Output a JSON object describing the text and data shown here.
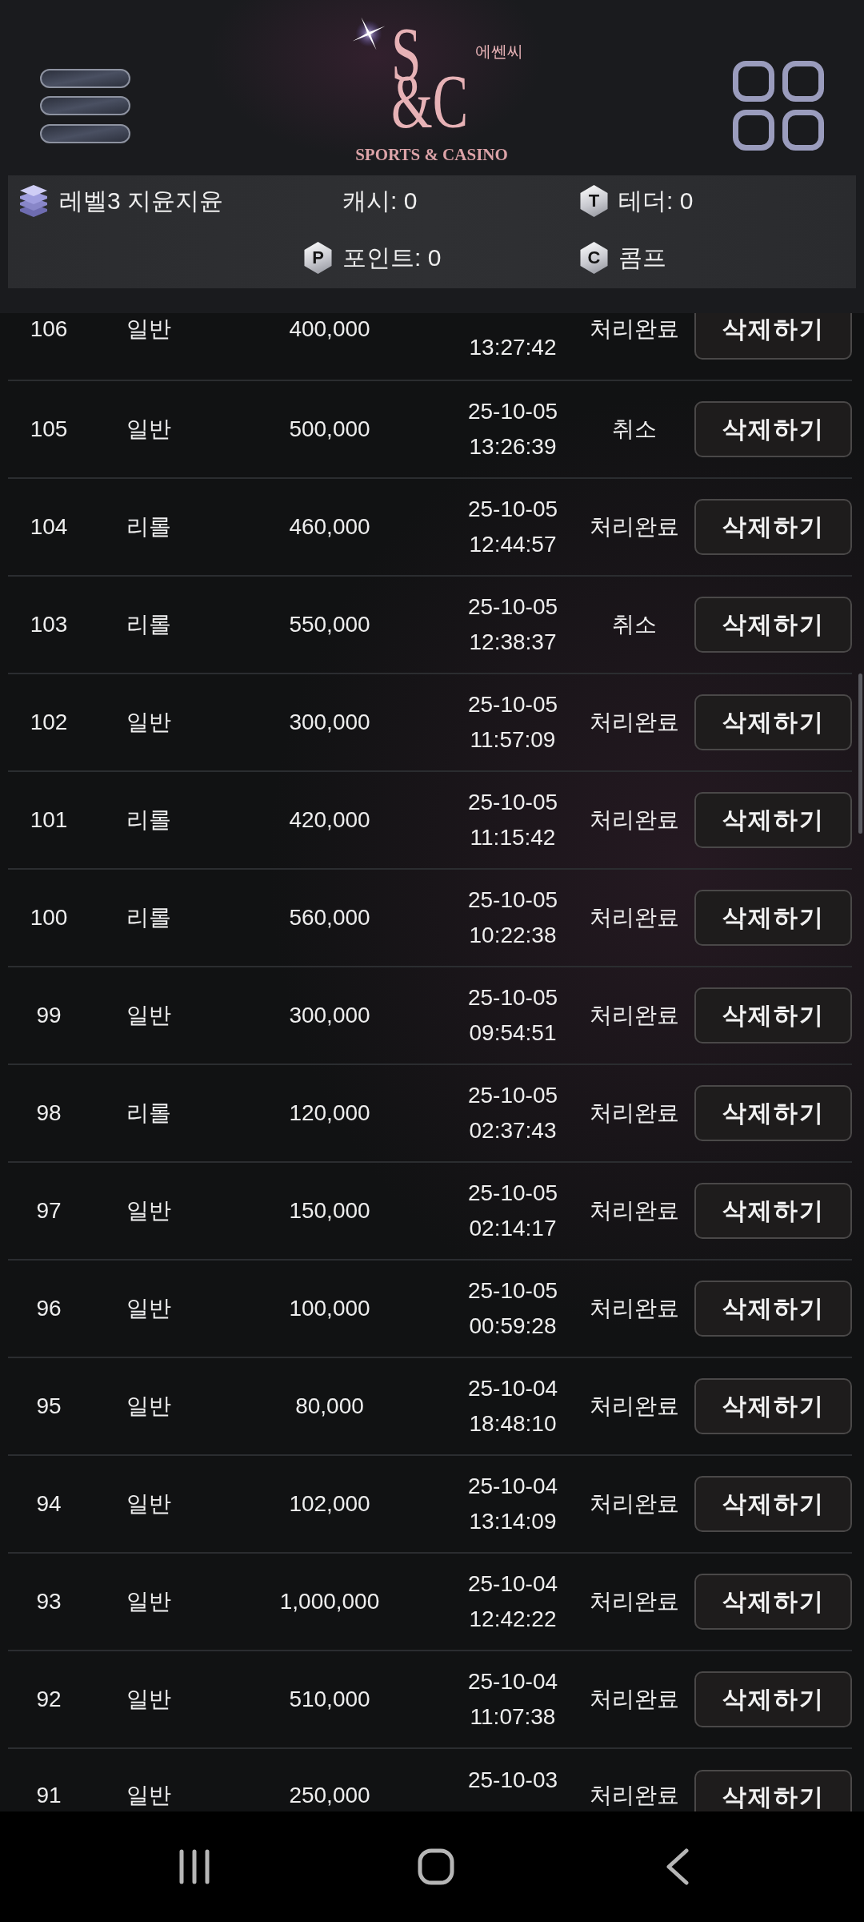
{
  "header": {
    "logo": {
      "monogram": [
        "S",
        "&C"
      ],
      "korean": "에쎈씨",
      "tagline": "SPORTS & CASINO"
    }
  },
  "info_bar": {
    "user": "레벨3 지윤지윤",
    "items": [
      {
        "label": "캐시: 0"
      },
      {
        "badge": "T",
        "label": "테더: 0"
      },
      {
        "badge": "P",
        "label": "포인트: 0"
      },
      {
        "badge": "C",
        "label": "콤프"
      }
    ]
  },
  "table": {
    "rows": [
      {
        "number": "106",
        "type": "일반",
        "amount": "400,000",
        "time": "13:27:42",
        "status": "처리완료",
        "button": "삭제하기"
      },
      {
        "number": "105",
        "type": "일반",
        "amount": "500,000",
        "date": "25-10-05",
        "time": "13:26:39",
        "status": "취소",
        "button": "삭제하기"
      },
      {
        "number": "104",
        "type": "리롤",
        "amount": "460,000",
        "date": "25-10-05",
        "time": "12:44:57",
        "status": "처리완료",
        "button": "삭제하기"
      },
      {
        "number": "103",
        "type": "리롤",
        "amount": "550,000",
        "date": "25-10-05",
        "time": "12:38:37",
        "status": "취소",
        "button": "삭제하기"
      },
      {
        "number": "102",
        "type": "일반",
        "amount": "300,000",
        "date": "25-10-05",
        "time": "11:57:09",
        "status": "처리완료",
        "button": "삭제하기"
      },
      {
        "number": "101",
        "type": "리롤",
        "amount": "420,000",
        "date": "25-10-05",
        "time": "11:15:42",
        "status": "처리완료",
        "button": "삭제하기"
      },
      {
        "number": "100",
        "type": "리롤",
        "amount": "560,000",
        "date": "25-10-05",
        "time": "10:22:38",
        "status": "처리완료",
        "button": "삭제하기"
      },
      {
        "number": "99",
        "type": "일반",
        "amount": "300,000",
        "date": "25-10-05",
        "time": "09:54:51",
        "status": "처리완료",
        "button": "삭제하기"
      },
      {
        "number": "98",
        "type": "리롤",
        "amount": "120,000",
        "date": "25-10-05",
        "time": "02:37:43",
        "status": "처리완료",
        "button": "삭제하기"
      },
      {
        "number": "97",
        "type": "일반",
        "amount": "150,000",
        "date": "25-10-05",
        "time": "02:14:17",
        "status": "처리완료",
        "button": "삭제하기"
      },
      {
        "number": "96",
        "type": "일반",
        "amount": "100,000",
        "date": "25-10-05",
        "time": "00:59:28",
        "status": "처리완료",
        "button": "삭제하기"
      },
      {
        "number": "95",
        "type": "일반",
        "amount": "80,000",
        "date": "25-10-04",
        "time": "18:48:10",
        "status": "처리완료",
        "button": "삭제하기"
      },
      {
        "number": "94",
        "type": "일반",
        "amount": "102,000",
        "date": "25-10-04",
        "time": "13:14:09",
        "status": "처리완료",
        "button": "삭제하기"
      },
      {
        "number": "93",
        "type": "일반",
        "amount": "1,000,000",
        "date": "25-10-04",
        "time": "12:42:22",
        "status": "처리완료",
        "button": "삭제하기"
      },
      {
        "number": "92",
        "type": "일반",
        "amount": "510,000",
        "date": "25-10-04",
        "time": "11:07:38",
        "status": "처리완료",
        "button": "삭제하기"
      },
      {
        "number": "91",
        "type": "일반",
        "amount": "250,000",
        "date": "25-10-03",
        "status": "처리완료",
        "button": "삭제하기"
      }
    ]
  }
}
